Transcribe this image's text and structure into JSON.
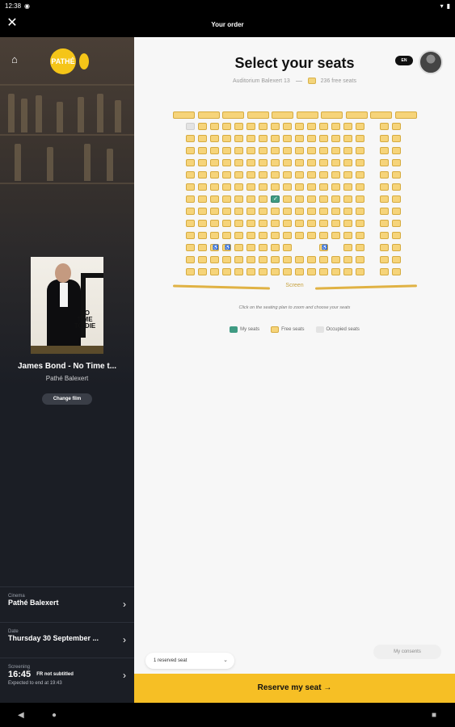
{
  "status": {
    "time": "12:38"
  },
  "topbar": {
    "title": "Your order",
    "close_icon": "close-icon"
  },
  "sidebar": {
    "movie_title": "James Bond - No Time t...",
    "cinema_name": "Pathé Balexert",
    "change_film": "Change film",
    "poster_title": "NO TIME TO DIE",
    "logo_text": "PATHÉ",
    "cinema": {
      "label": "Cinema",
      "value": "Pathé Balexert"
    },
    "date": {
      "label": "Date",
      "value": "Thursday 30 September ..."
    },
    "screening": {
      "label": "Screening",
      "time": "16:45",
      "badge": "FR not subtitled",
      "expected": "Expected to end at 19:43"
    }
  },
  "main": {
    "heading": "Select your seats",
    "auditorium": "Auditorium Balexert 13",
    "free_seats": "236 free seats",
    "lang_badge": "EN",
    "screen_label": "Screen",
    "hint": "Click on the seating plan to zoom and choose your seats",
    "legend": {
      "mine": "My seats",
      "free": "Free seats",
      "occupied": "Occupied seats"
    },
    "reserved_select": "1 reserved seat",
    "consents": "My consents",
    "reserve_button": "Reserve my seat →"
  },
  "colors": {
    "accent": "#f6bf25",
    "free_seat": "#f6d47a",
    "my_seat": "#3f9b83",
    "occupied": "#e3e3e3",
    "sidebar_bg": "#1b1e25"
  }
}
